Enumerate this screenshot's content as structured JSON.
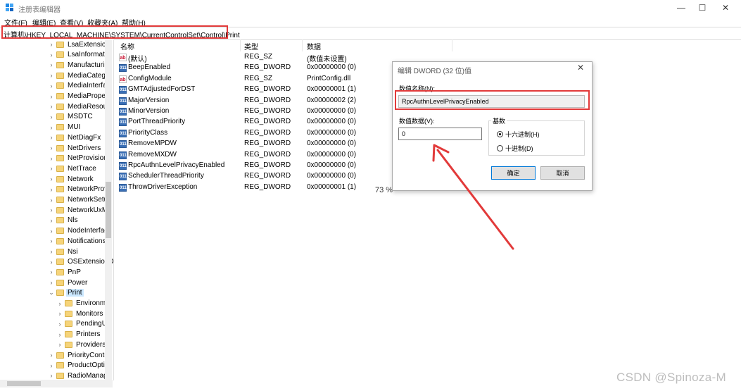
{
  "window": {
    "title": "注册表编辑器",
    "minimize": "—",
    "maximize": "☐",
    "close": "✕"
  },
  "menu": [
    "文件(F)",
    "编辑(E)",
    "查看(V)",
    "收藏夹(A)",
    "帮助(H)"
  ],
  "address": "计算机\\HKEY_LOCAL_MACHINE\\SYSTEM\\CurrentControlSet\\Control\\Print",
  "tree": {
    "chevron_closed": "›",
    "chevron_open": "⌄",
    "items": [
      {
        "label": "LsaExtension"
      },
      {
        "label": "LsaInformatic"
      },
      {
        "label": "Manufacturin"
      },
      {
        "label": "MediaCatego"
      },
      {
        "label": "MediaInterfa"
      },
      {
        "label": "MediaProper"
      },
      {
        "label": "MediaResour"
      },
      {
        "label": "MSDTC"
      },
      {
        "label": "MUI"
      },
      {
        "label": "NetDiagFx"
      },
      {
        "label": "NetDrivers"
      },
      {
        "label": "NetProvision"
      },
      {
        "label": "NetTrace"
      },
      {
        "label": "Network"
      },
      {
        "label": "NetworkProv"
      },
      {
        "label": "NetworkSetu"
      },
      {
        "label": "NetworkUxM"
      },
      {
        "label": "Nls"
      },
      {
        "label": "NodeInterfac"
      },
      {
        "label": "Notifications"
      },
      {
        "label": "Nsi"
      },
      {
        "label": "OSExtensionD"
      },
      {
        "label": "PnP"
      },
      {
        "label": "Power"
      },
      {
        "label": "Print",
        "expanded": true,
        "selected": true
      },
      {
        "label": "Environme",
        "child": true
      },
      {
        "label": "Monitors",
        "child": true
      },
      {
        "label": "PendingUp",
        "child": true
      },
      {
        "label": "Printers",
        "child": true
      },
      {
        "label": "Providers",
        "child": true
      },
      {
        "label": "PriorityContro"
      },
      {
        "label": "ProductOptio"
      },
      {
        "label": "RadioManag"
      }
    ]
  },
  "columns": {
    "name": "名称",
    "type": "类型",
    "data": "数据"
  },
  "values": [
    {
      "name": "(默认)",
      "type": "REG_SZ",
      "data": "(数值未设置)",
      "icon": "string-value-icon"
    },
    {
      "name": "BeepEnabled",
      "type": "REG_DWORD",
      "data": "0x00000000 (0)",
      "icon": "binary-value-icon"
    },
    {
      "name": "ConfigModule",
      "type": "REG_SZ",
      "data": "PrintConfig.dll",
      "icon": "string-value-icon"
    },
    {
      "name": "GMTAdjustedForDST",
      "type": "REG_DWORD",
      "data": "0x00000001 (1)",
      "icon": "binary-value-icon"
    },
    {
      "name": "MajorVersion",
      "type": "REG_DWORD",
      "data": "0x00000002 (2)",
      "icon": "binary-value-icon"
    },
    {
      "name": "MinorVersion",
      "type": "REG_DWORD",
      "data": "0x00000000 (0)",
      "icon": "binary-value-icon"
    },
    {
      "name": "PortThreadPriority",
      "type": "REG_DWORD",
      "data": "0x00000000 (0)",
      "icon": "binary-value-icon"
    },
    {
      "name": "PriorityClass",
      "type": "REG_DWORD",
      "data": "0x00000000 (0)",
      "icon": "binary-value-icon"
    },
    {
      "name": "RemoveMPDW",
      "type": "REG_DWORD",
      "data": "0x00000000 (0)",
      "icon": "binary-value-icon"
    },
    {
      "name": "RemoveMXDW",
      "type": "REG_DWORD",
      "data": "0x00000000 (0)",
      "icon": "binary-value-icon"
    },
    {
      "name": "RpcAuthnLevelPrivacyEnabled",
      "type": "REG_DWORD",
      "data": "0x00000000 (0)",
      "icon": "binary-value-icon"
    },
    {
      "name": "SchedulerThreadPriority",
      "type": "REG_DWORD",
      "data": "0x00000000 (0)",
      "icon": "binary-value-icon"
    },
    {
      "name": "ThrowDriverException",
      "type": "REG_DWORD",
      "data": "0x00000001 (1)",
      "icon": "binary-value-icon"
    }
  ],
  "icons": {
    "string_glyph": "ab",
    "binary_glyph": "011"
  },
  "zoom": "73 %",
  "dialog": {
    "title": "编辑 DWORD (32 位)值",
    "close": "✕",
    "name_label": "数值名称(N):",
    "name_value": "RpcAuthnLevelPrivacyEnabled",
    "data_label": "数值数据(V):",
    "data_value": "0",
    "base_label": "基数",
    "hex_label": "十六进制(H)",
    "dec_label": "十进制(D)",
    "ok": "确定",
    "cancel": "取消"
  },
  "watermark": "CSDN @Spinoza-M",
  "colors": {
    "highlight_red": "#e23a3a",
    "selection_blue": "#cce8ff",
    "folder_yellow": "#f6d47a"
  }
}
